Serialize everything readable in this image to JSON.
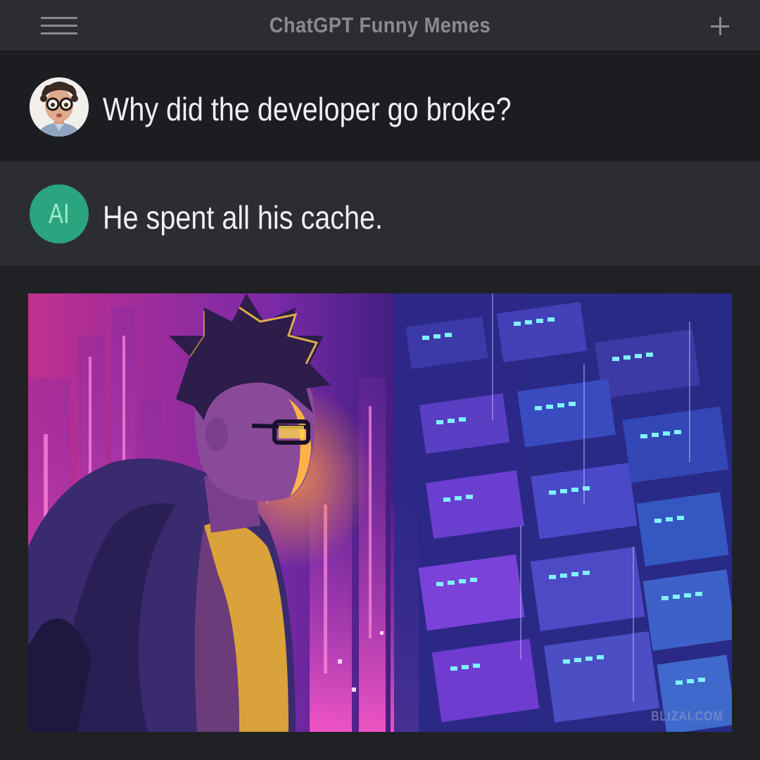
{
  "header": {
    "title": "ChatGPT Funny Memes",
    "menu_icon": "hamburger-menu-icon",
    "new_icon": "plus-icon"
  },
  "conversation": [
    {
      "role": "user",
      "avatar": "user-photo-avatar",
      "text": "Why did the developer go broke?"
    },
    {
      "role": "assistant",
      "avatar_label": "AI",
      "text": "He spent all his cache."
    }
  ],
  "illustration": {
    "subject": "developer with glasses facing a neon cyberpunk data wall",
    "watermark": "BLIZAI.COM"
  },
  "colors": {
    "header_bg": "#2c2d33",
    "user_row_bg": "#1c1d21",
    "ai_row_bg": "#2c2d33",
    "page_bg": "#202125",
    "ai_avatar": "#2aa57f",
    "neon_pink": "#ff3fbf",
    "neon_blue": "#4fd7ff",
    "neon_purple": "#7b3fe0"
  }
}
